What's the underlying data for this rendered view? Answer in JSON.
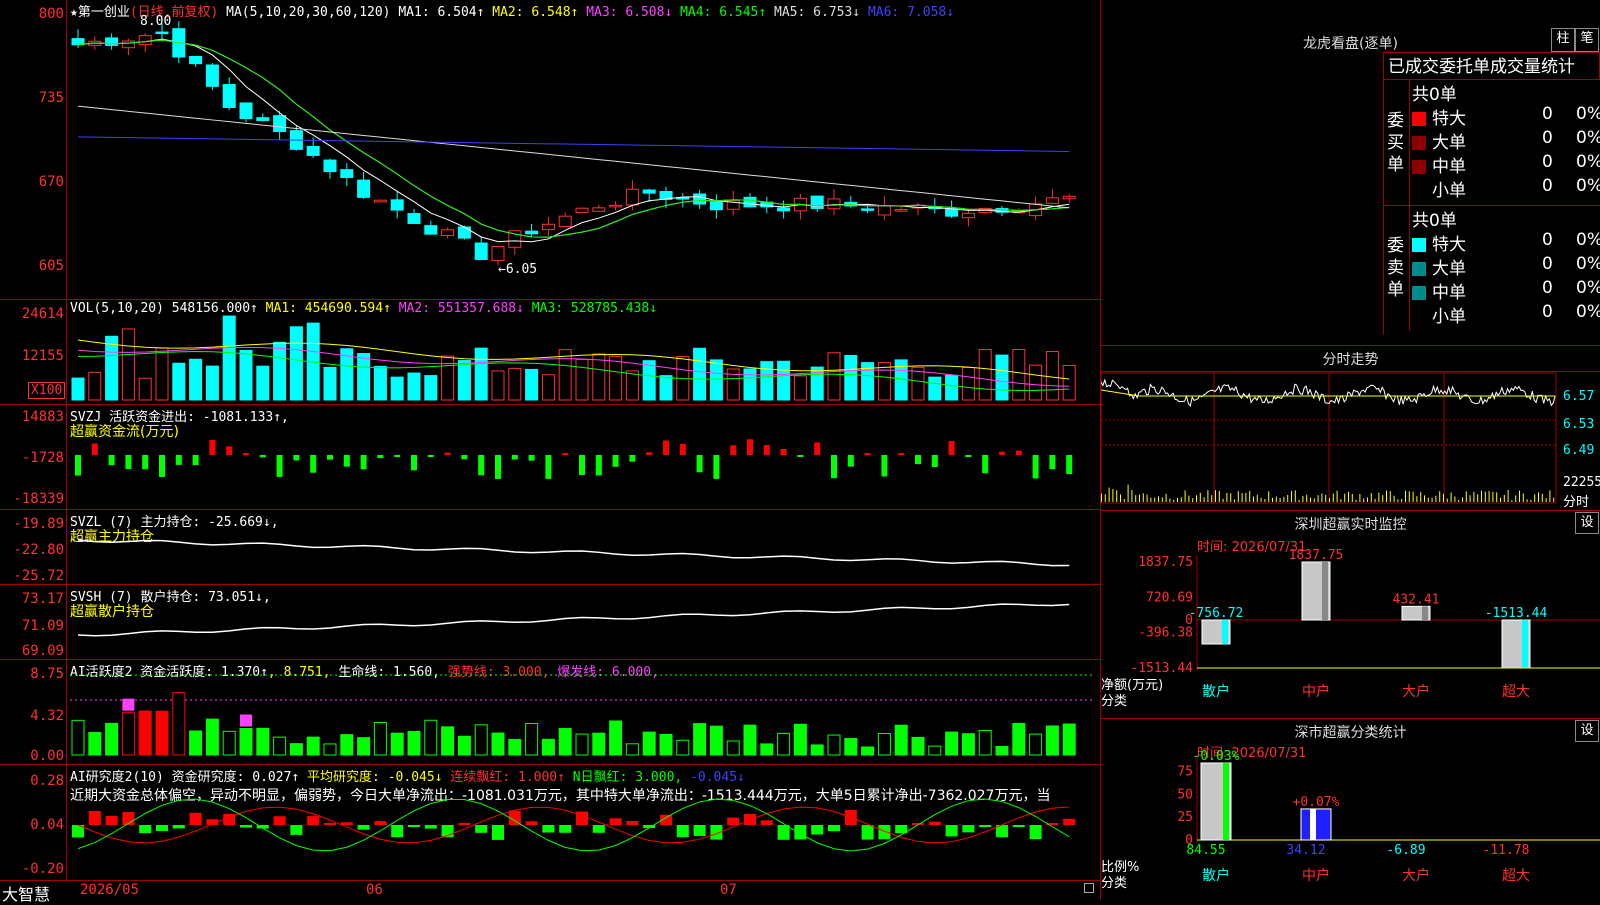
{
  "main": {
    "title": "★第一创业",
    "period": "(日线,前复权)",
    "ma_label": "MA(5,10,20,30,60,120)",
    "ma1": "MA1: 6.504↑",
    "ma2": "MA2: 6.548↑",
    "ma3": "MA3: 6.508↓",
    "ma4": "MA4: 6.545↑",
    "ma5": "MA5: 6.753↓",
    "ma6": "MA6: 7.058↓",
    "yticks": [
      "800",
      "735",
      "670",
      "605"
    ],
    "high_label": "8.00",
    "low_label": "←6.05"
  },
  "vol": {
    "label": "VOL(5,10,20)",
    "value": "548156.000↑",
    "ma1": "MA1: 454690.594↑",
    "ma2": "MA2: 551357.688↓",
    "ma3": "MA3: 528785.438↓",
    "yticks": [
      "24614",
      "12155"
    ],
    "unit": "X100"
  },
  "svzj": {
    "label": "SVZJ  活跃资金进出: -1081.133↑,",
    "sub": "超赢资金流(万元)",
    "yticks": [
      "14883",
      "-1728",
      "-18339"
    ]
  },
  "svzl": {
    "label": "SVZL (7) 主力持仓: -25.669↓,",
    "sub": "超赢主力持仓",
    "yticks": [
      "-19.89",
      "-22.80",
      "-25.72"
    ]
  },
  "svsh": {
    "label": "SVSH (7) 散户持仓: 73.051↓,",
    "sub": "超赢散户持仓",
    "yticks": [
      "73.17",
      "71.09",
      "69.09"
    ]
  },
  "ai1": {
    "label": "AI活跃度2 资金活跃度: 1.370↑",
    "v2": ", 8.751,",
    "v3": " 生命线: 1.560,",
    "v4": " 强势线: 3.000,",
    "v5": " 爆发线: 6.000,",
    "yticks": [
      "8.75",
      "4.32",
      "0.00"
    ]
  },
  "ai2": {
    "label": "AI研究度2(10) 资金研究度: 0.027↑",
    "v2": " 平均研究度: -0.045↓",
    "v3": " 连续飘红: 1.000↑",
    "v4": " N日飘红: 3.000,",
    "v5": " -0.045↓",
    "text": "近期大资金总体偏空，异动不明显，偏弱势，今日大单净流出：-1081.031万元，其中特大单净流出：-1513.444万元，大单5日累计净出-7362.027万元，当",
    "yticks": [
      "0.28",
      "0.04",
      "-0.20"
    ]
  },
  "xaxis": {
    "app": "大智慧",
    "labels": [
      "2026/05",
      "06",
      "07"
    ]
  },
  "longhu": {
    "title": "龙虎看盘(逐单)",
    "btn1": "柱",
    "btn2": "笔",
    "subtitle": "已成交委托单成交量统计",
    "buy_label": "委买单",
    "sell_label": "委卖单",
    "buy_total": "共0单",
    "sell_total": "共0单",
    "buy_rows": [
      {
        "name": "特大",
        "val": "0",
        "pct": "0%",
        "color": "#ff0000"
      },
      {
        "name": "大单",
        "val": "0",
        "pct": "0%",
        "color": "#8b0000"
      },
      {
        "name": "中单",
        "val": "0",
        "pct": "0%",
        "color": "#8b0000"
      },
      {
        "name": "小单",
        "val": "0",
        "pct": "0%",
        "color": "#000000"
      }
    ],
    "sell_rows": [
      {
        "name": "特大",
        "val": "0",
        "pct": "0%",
        "color": "#00ffff"
      },
      {
        "name": "大单",
        "val": "0",
        "pct": "0%",
        "color": "#008b8b"
      },
      {
        "name": "中单",
        "val": "0",
        "pct": "0%",
        "color": "#008b8b"
      },
      {
        "name": "小单",
        "val": "0",
        "pct": "0%",
        "color": "#000000"
      }
    ]
  },
  "fenshi": {
    "title": "分时走势",
    "yticks": [
      "6.57",
      "6.53",
      "6.49"
    ],
    "vol_tick": "22255",
    "vol_unit": "分时"
  },
  "monitor": {
    "title": "深圳超赢实时监控",
    "btn": "设",
    "time": "时间: 2026/07/31",
    "yticks": [
      "1837.75",
      "720.69",
      "0",
      "-396.38",
      "-1513.44"
    ],
    "ylabel": "净额(万元)",
    "xlabel": "分类",
    "cats": [
      "散户",
      "中户",
      "大户",
      "超大"
    ],
    "values": [
      -756.72,
      1837.75,
      432.41,
      -1513.44
    ],
    "value_labels": [
      "-756.72",
      "1837.75",
      "432.41",
      "-1513.44"
    ]
  },
  "classify": {
    "title": "深市超赢分类统计",
    "btn": "设",
    "time": "时间: 2026/07/31",
    "yticks": [
      "75",
      "50",
      "25",
      "0"
    ],
    "ylabel": "比例%",
    "xlabel": "分类",
    "cats": [
      "散户",
      "中户",
      "大户",
      "超大"
    ],
    "bar_labels": [
      "-0.03%",
      "+0.07%"
    ],
    "bottom_values": [
      "84.55",
      "34.12",
      "-6.89",
      "-11.78"
    ]
  },
  "colors": {
    "up": "#ff3030",
    "down": "#00ffff",
    "grid": "#a00000"
  }
}
